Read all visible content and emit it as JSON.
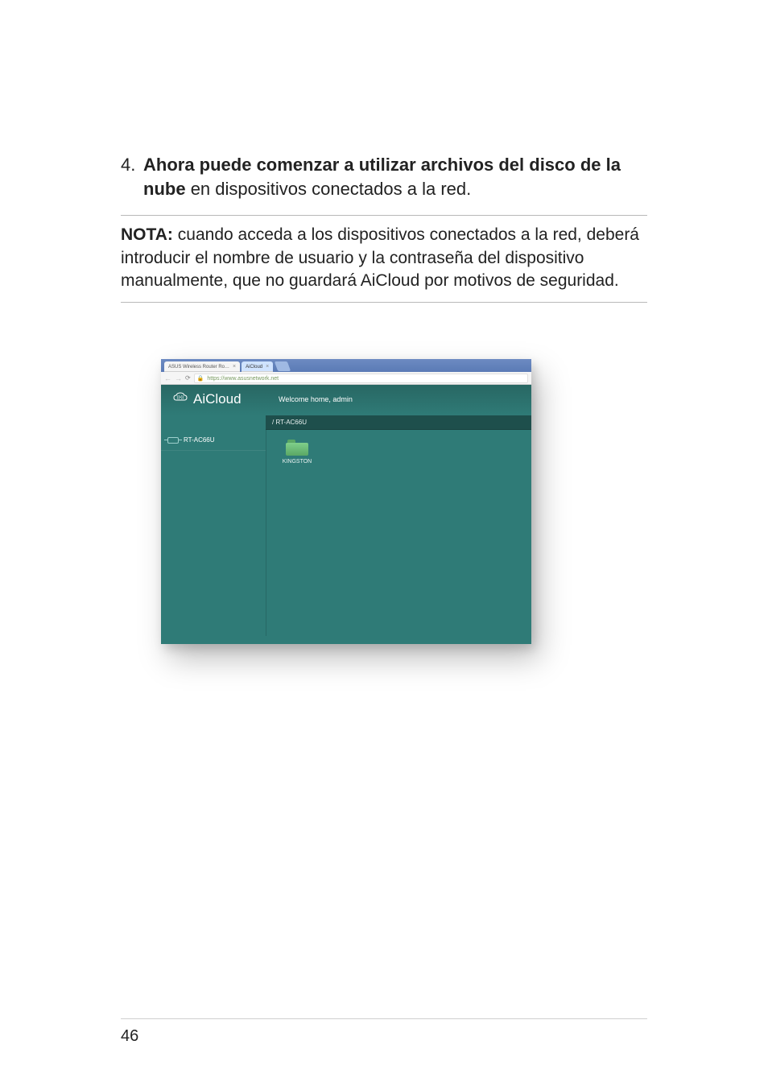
{
  "instruction": {
    "number": "4.",
    "bold": "Ahora puede comenzar a utilizar archivos del disco de la nube",
    "rest": "en dispositivos conectados a la red."
  },
  "note": {
    "label": "NOTA:",
    "text": "cuando acceda a los dispositivos conectados a la red, deberá introducir el nombre de usuario y la contraseña del dispositivo manualmente, que no guardará AiCloud por motivos de seguridad."
  },
  "browser": {
    "tab1": "ASUS Wireless Router Ro…",
    "tab2": "AiCloud",
    "url": "https://www.asusnetwork.net"
  },
  "aicloud": {
    "logo": "AiCloud",
    "welcome": "Welcome home, admin",
    "breadcrumb": "/ RT-AC66U",
    "sidebar": {
      "device": "RT-AC66U"
    },
    "folder": "KINGSTON"
  },
  "page_number": "46"
}
